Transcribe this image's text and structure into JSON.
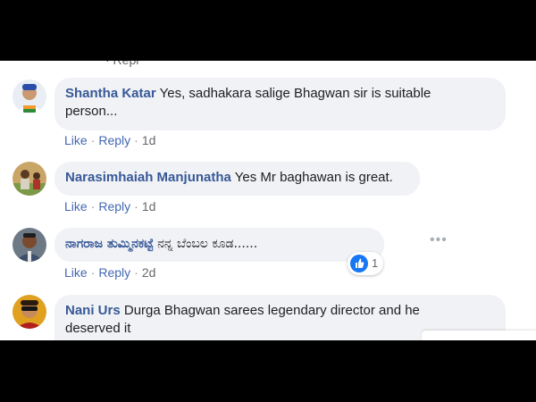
{
  "colors": {
    "background": "#000000",
    "panel": "#ffffff",
    "bubble": "#f0f2f5",
    "author": "#385898",
    "link": "#4267b2",
    "like_blue": "#1877f2"
  },
  "comments": [
    {
      "author": "Shantha Katar",
      "text": "Yes, sadhakara salige Bhagwan sir is suitable",
      "text_line2": "person...",
      "like_label": "Like",
      "reply_label": "Reply",
      "time": "1d",
      "avatar_icon": "profile-photo"
    },
    {
      "author": "Narasimhaiah Manjunatha",
      "text": "Yes Mr baghawan is great.",
      "like_label": "Like",
      "reply_label": "Reply",
      "time": "1d",
      "avatar_icon": "profile-photo",
      "more_icon": "more-options-icon"
    },
    {
      "author": "ನಾಗರಾಜ ತುಮ್ಮಿನಕಟ್ಟೆ",
      "text": "ನನ್ನ ಬೆಂಬಲ ಕೂಡ......",
      "like_label": "Like",
      "reply_label": "Reply",
      "time": "2d",
      "avatar_icon": "profile-photo",
      "reaction_icon": "like-reaction-icon",
      "reaction_count": "1"
    },
    {
      "author": "Nani Urs",
      "text": "Durga Bhagwan sarees legendary director and he",
      "text_line2": "deserved it",
      "avatar_icon": "profile-photo"
    }
  ]
}
